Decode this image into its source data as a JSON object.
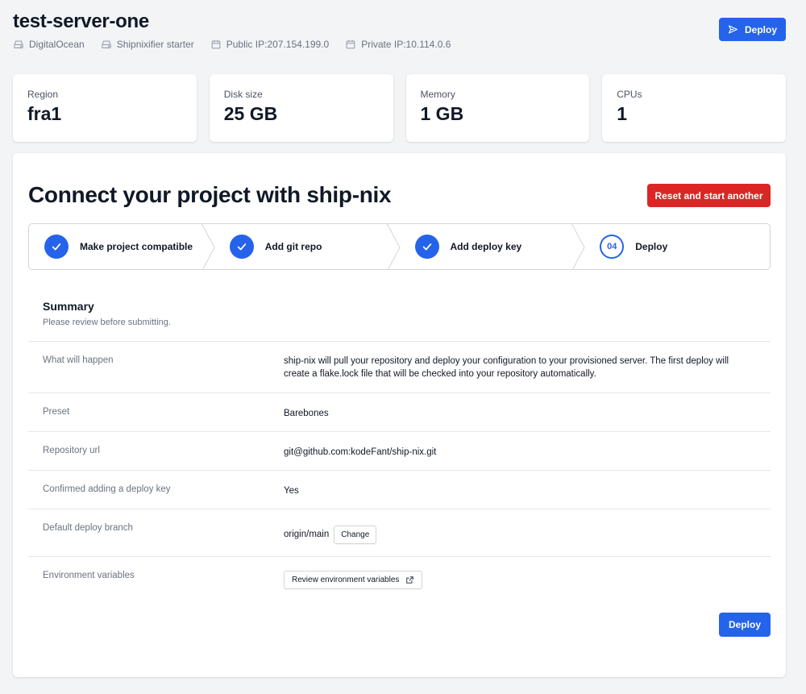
{
  "header": {
    "title": "test-server-one",
    "meta": [
      {
        "icon": "server-icon",
        "text": "DigitalOcean"
      },
      {
        "icon": "server-icon",
        "text": "Shipnixifier starter"
      },
      {
        "icon": "calendar-icon",
        "text": "Public IP:207.154.199.0"
      },
      {
        "icon": "calendar-icon",
        "text": "Private IP:10.114.0.6"
      }
    ],
    "deploy_label": "Deploy"
  },
  "stats": [
    {
      "label": "Region",
      "value": "fra1"
    },
    {
      "label": "Disk size",
      "value": "25 GB"
    },
    {
      "label": "Memory",
      "value": "1 GB"
    },
    {
      "label": "CPUs",
      "value": "1"
    }
  ],
  "main": {
    "title": "Connect your project with ship-nix",
    "reset_label": "Reset and start another",
    "steps": [
      {
        "label": "Make project compatible",
        "status": "done"
      },
      {
        "label": "Add git repo",
        "status": "done"
      },
      {
        "label": "Add deploy key",
        "status": "done"
      },
      {
        "label": "Deploy",
        "status": "current",
        "number": "04"
      }
    ],
    "summary": {
      "title": "Summary",
      "subtitle": "Please review before submitting.",
      "rows": [
        {
          "label": "What will happen",
          "value": "ship-nix will pull your repository and deploy your configuration to your provisioned server. The first deploy will create a flake.lock file that will be checked into your repository automatically."
        },
        {
          "label": "Preset",
          "value": "Barebones"
        },
        {
          "label": "Repository url",
          "value": "git@github.com:kodeFant/ship-nix.git"
        },
        {
          "label": "Confirmed adding a deploy key",
          "value": "Yes"
        },
        {
          "label": "Default deploy branch",
          "value": "origin/main",
          "button": "Change"
        },
        {
          "label": "Environment variables",
          "button": "Review environment variables"
        }
      ]
    },
    "deploy_label": "Deploy"
  },
  "colors": {
    "primary": "#2563eb",
    "danger": "#dc2626",
    "background": "#f3f4f6"
  }
}
